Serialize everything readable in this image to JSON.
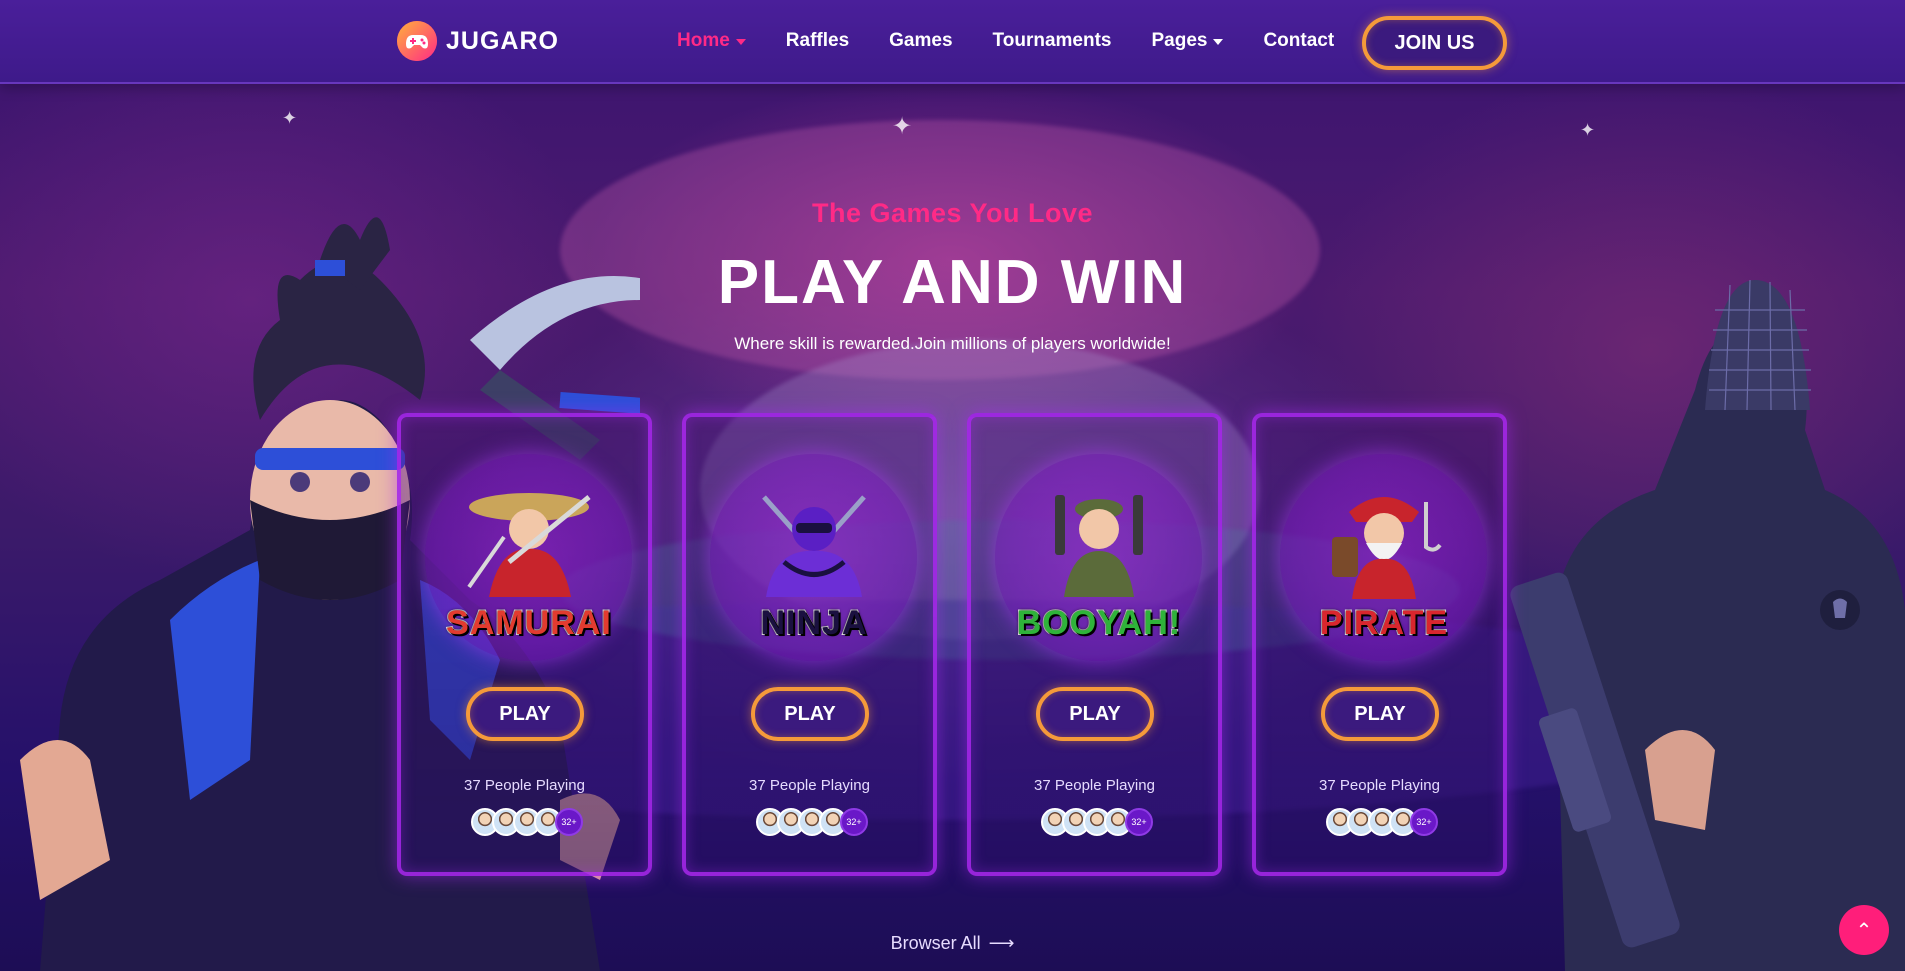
{
  "brand": {
    "name": "JUGARO",
    "icon": "gamepad-icon"
  },
  "nav": {
    "items": [
      {
        "label": "Home",
        "active": true,
        "dropdown": true
      },
      {
        "label": "Raffles",
        "active": false,
        "dropdown": false
      },
      {
        "label": "Games",
        "active": false,
        "dropdown": false
      },
      {
        "label": "Tournaments",
        "active": false,
        "dropdown": false
      },
      {
        "label": "Pages",
        "active": false,
        "dropdown": true
      },
      {
        "label": "Contact",
        "active": false,
        "dropdown": false
      }
    ],
    "join_label": "JOIN US"
  },
  "hero": {
    "eyebrow": "The Games You Love",
    "title": "PLAY AND WIN",
    "subtitle": "Where skill is rewarded.Join millions of players worldwide!"
  },
  "cards": [
    {
      "emblem": "SAMURAI",
      "emblem_color": "#e23b2f",
      "play_label": "PLAY",
      "players": "37 People Playing",
      "more": "32+"
    },
    {
      "emblem": "NINJA",
      "emblem_color": "#6c2ed6",
      "play_label": "PLAY",
      "players": "37 People Playing",
      "more": "32+"
    },
    {
      "emblem": "BOOYAH!",
      "emblem_color": "#2fb33a",
      "play_label": "PLAY",
      "players": "37 People Playing",
      "more": "32+"
    },
    {
      "emblem": "PIRATE",
      "emblem_color": "#d9262e",
      "play_label": "PLAY",
      "players": "37 People Playing",
      "more": "32+"
    }
  ],
  "browse": {
    "label": "Browser All",
    "icon": "arrow-right-icon"
  },
  "back_to_top": {
    "icon": "chevron-up-icon"
  },
  "colors": {
    "accent": "#ff2a86",
    "button_border": "#f59a3a",
    "card_border": "#aa28f0",
    "nav_bg": "#4a1f9a"
  }
}
